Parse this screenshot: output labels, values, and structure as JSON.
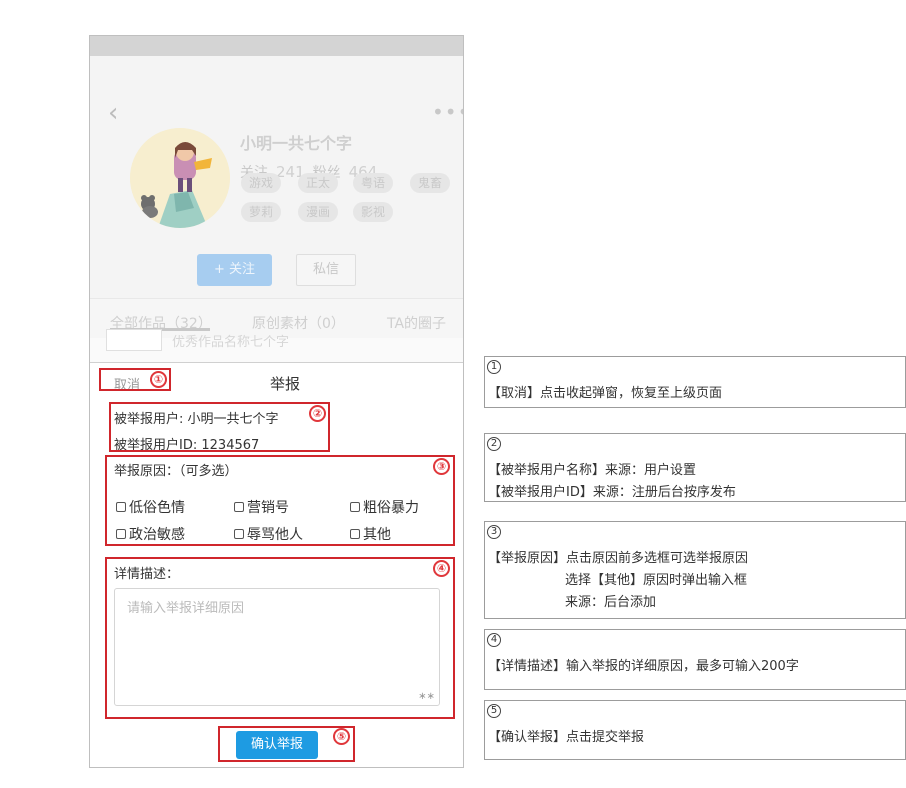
{
  "profile": {
    "user_name": "小明一共七个字",
    "following_label": "关注",
    "following_count": "241",
    "followers_label": "粉丝",
    "followers_count": "464",
    "tags": [
      "游戏",
      "正太",
      "粤语",
      "鬼畜",
      "萝莉",
      "漫画",
      "影视"
    ],
    "follow_button": "+ 关注",
    "message_button": "私信",
    "tabs": [
      "全部作品（32）",
      "原创素材（0）",
      "TA的圈子"
    ],
    "work_item_title": "优秀作品名称七个字"
  },
  "dialog": {
    "cancel": "取消",
    "title": "举报",
    "reported_user_label": "被举报用户:",
    "reported_user_value": "小明一共七个字",
    "reported_id_label": "被举报用户ID:",
    "reported_id_value": "1234567",
    "reasons_label": "举报原因：（可多选）",
    "reasons": [
      "低俗色情",
      "营销号",
      "粗俗暴力",
      "政治敏感",
      "辱骂他人",
      "其他"
    ],
    "detail_label": "详情描述：",
    "detail_placeholder": "请输入举报详细原因",
    "submit": "确认举报"
  },
  "callouts": [
    "①",
    "②",
    "③",
    "④",
    "⑤"
  ],
  "notes": [
    {
      "num": "1",
      "lines": [
        "【取消】点击收起弹窗，恢复至上级页面"
      ]
    },
    {
      "num": "2",
      "lines": [
        "【被举报用户名称】来源：用户设置",
        "【被举报用户ID】来源：注册后台按序发布"
      ]
    },
    {
      "num": "3",
      "lines": [
        "【举报原因】点击原因前多选框可选举报原因",
        "选择【其他】原因时弹出输入框",
        "来源：后台添加"
      ]
    },
    {
      "num": "4",
      "lines": [
        "【详情描述】输入举报的详细原因，最多可输入200字"
      ]
    },
    {
      "num": "5",
      "lines": [
        "【确认举报】点击提交举报"
      ]
    }
  ],
  "colors": {
    "accent": "#1e9be2",
    "callout_red": "#d0262c"
  }
}
